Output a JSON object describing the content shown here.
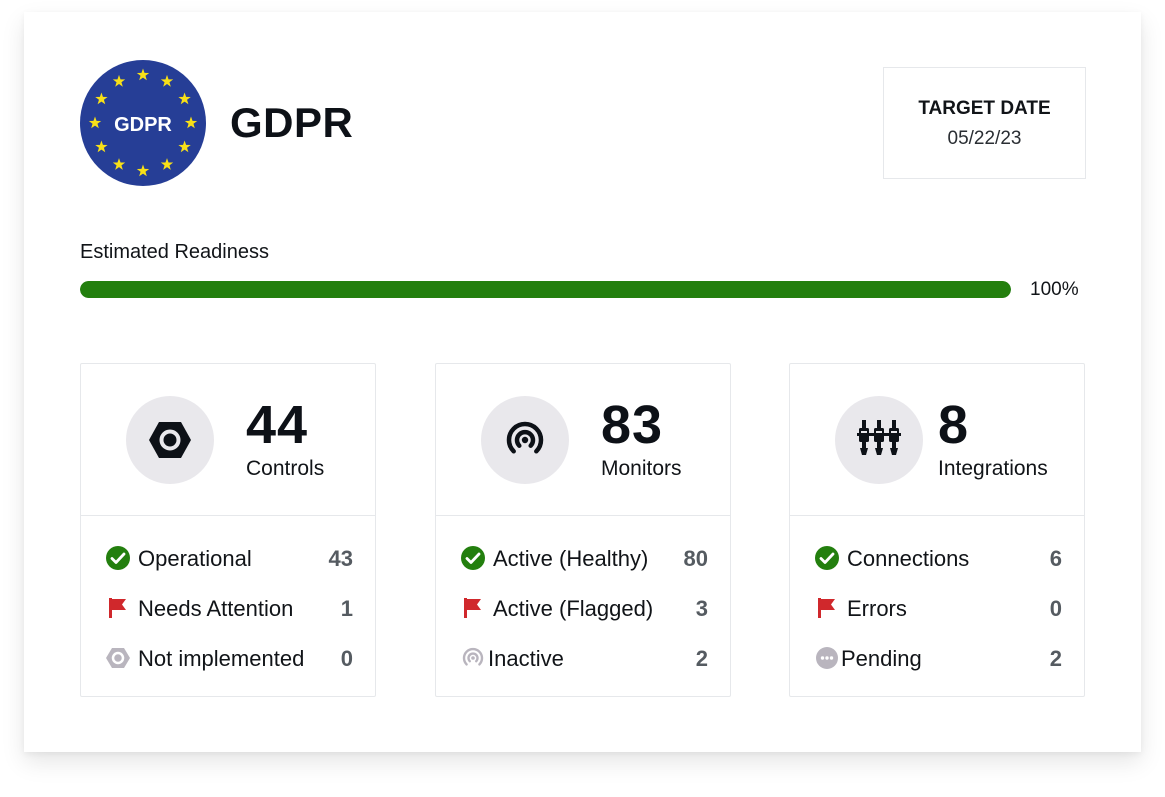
{
  "framework": {
    "logo_text": "GDPR",
    "title": "GDPR"
  },
  "target": {
    "label": "TARGET DATE",
    "value": "05/22/23"
  },
  "readiness": {
    "label": "Estimated Readiness",
    "percent": 100,
    "percent_text": "100%"
  },
  "colors": {
    "progress": "#237f0e",
    "healthy": "#237f0e",
    "flag": "#d0282c",
    "inactive": "#b9b5be",
    "eu_blue": "#263e96",
    "eu_star": "#f8e018"
  },
  "stats": [
    {
      "icon": "hexagon-nut-icon",
      "number": "44",
      "label": "Controls",
      "rows": [
        {
          "icon": "check-circle-icon",
          "label": "Operational",
          "count": "43"
        },
        {
          "icon": "flag-icon",
          "label": "Needs Attention",
          "count": "1"
        },
        {
          "icon": "hexagon-outline-icon",
          "label": "Not implemented",
          "count": "0"
        }
      ]
    },
    {
      "icon": "signal-broadcast-icon",
      "number": "83",
      "label": "Monitors",
      "rows": [
        {
          "icon": "check-circle-icon",
          "label": "Active (Healthy)",
          "count": "80"
        },
        {
          "icon": "flag-icon",
          "label": "Active (Flagged)",
          "count": "3"
        },
        {
          "icon": "signal-inactive-icon",
          "label": "Inactive",
          "count": "2"
        }
      ]
    },
    {
      "icon": "plug-connectors-icon",
      "number": "8",
      "label": "Integrations",
      "rows": [
        {
          "icon": "check-circle-icon",
          "label": "Connections",
          "count": "6"
        },
        {
          "icon": "flag-icon",
          "label": "Errors",
          "count": "0"
        },
        {
          "icon": "pending-dots-icon",
          "label": "Pending",
          "count": "2"
        }
      ]
    }
  ]
}
